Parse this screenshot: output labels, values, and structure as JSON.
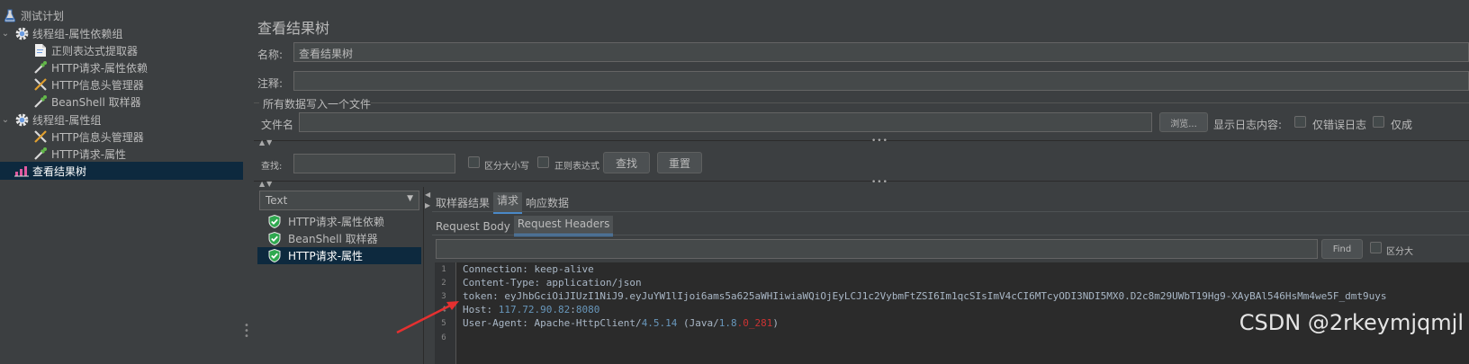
{
  "tree": {
    "items": [
      {
        "label": "测试计划"
      },
      {
        "label": "线程组-属性依赖组"
      },
      {
        "label": "正则表达式提取器"
      },
      {
        "label": "HTTP请求-属性依赖"
      },
      {
        "label": "HTTP信息头管理器"
      },
      {
        "label": "BeanShell 取样器"
      },
      {
        "label": "线程组-属性组"
      },
      {
        "label": "HTTP信息头管理器"
      },
      {
        "label": "HTTP请求-属性"
      },
      {
        "label": "查看结果树"
      }
    ]
  },
  "panel": {
    "title": "查看结果树",
    "name_label": "名称:",
    "name_value": "查看结果树",
    "comment_label": "注释:",
    "comment_value": "",
    "write_all_label": "所有数据写入一个文件",
    "filename_label": "文件名",
    "filename_value": "",
    "browse_label": "浏览...",
    "log_content_label": "显示日志内容:",
    "errors_only_label": "仅错误日志",
    "success_only_label": "仅成"
  },
  "search": {
    "label": "查找:",
    "value": "",
    "case_label": "区分大小写",
    "regex_label": "正则表达式",
    "find_label": "查找",
    "reset_label": "重置"
  },
  "results": {
    "renderer_selected": "Text",
    "items": [
      {
        "label": "HTTP请求-属性依赖",
        "status": "success"
      },
      {
        "label": "BeanShell 取样器",
        "status": "success"
      },
      {
        "label": "HTTP请求-属性",
        "status": "success"
      }
    ]
  },
  "detail": {
    "tabs": [
      {
        "label": "取样器结果"
      },
      {
        "label": "请求"
      },
      {
        "label": "响应数据"
      }
    ],
    "subtabs": [
      {
        "label": "Request Body"
      },
      {
        "label": "Request Headers"
      }
    ],
    "find_value": "",
    "find_label": "Find",
    "case_label": "区分大"
  },
  "code": {
    "line_numbers": [
      "1",
      "2",
      "3",
      "4",
      "5",
      "6"
    ],
    "l1": "Connection: keep-alive",
    "l2": "Content-Type: application/json",
    "l3": "token: eyJhbGciOiJIUzI1NiJ9.eyJuYW1lIjoi6ams5a625aWHIiwiaWQiOjEyLCJ1c2VybmFtZSI6Im1qcSIsImV4cCI6MTcyODI3NDI5MX0.D2c8m29UWbT19Hg9-XAyBAl546HsMm4we5F_dmt9uys",
    "l4_key": "Host: ",
    "l4_ip": "117.72.90.82",
    "l4_colon": ":",
    "l4_port": "8080",
    "l5_pre": "User-Agent: Apache-HttpClient/",
    "l5_ver": "4.5.14",
    "l5_mid": " (Java/",
    "l5_j1": "1.8",
    "l5_j2": ".0_281",
    "l5_end": ")"
  },
  "watermark": "CSDN @2rkeymjqmjl",
  "colors": {
    "background": "#3c3f41",
    "selection": "#0d293e",
    "accent": "#4a88c7",
    "success": "#2fa84f",
    "arrow": "#e53030"
  }
}
